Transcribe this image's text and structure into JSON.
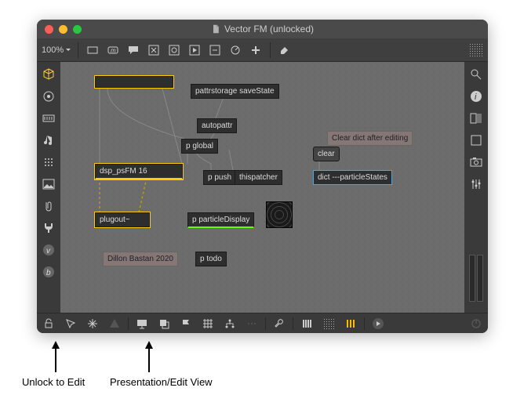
{
  "window": {
    "title": "Vector FM (unlocked)",
    "traffic": {
      "close": "#ff5f57",
      "min": "#febc2e",
      "max": "#28c840"
    }
  },
  "toolbar": {
    "zoom": "100%"
  },
  "objects": {
    "pattrstorage": "pattrstorage saveState",
    "autopattr": "autopattr",
    "pglobal": "p global",
    "ppush": "p push",
    "thispatcher": "thispatcher",
    "dsp": "dsp_psFM 16",
    "cleardict_comment": "Clear dict after editing",
    "clear": "clear",
    "dict": "dict ---particleStates",
    "plugout": "plugout~",
    "pparticle": "p particleDisplay",
    "credit": "Dillon Bastan 2020",
    "ptodo": "p todo"
  },
  "annotations": {
    "unlock": "Unlock to Edit",
    "presview": "Presentation/Edit View"
  }
}
